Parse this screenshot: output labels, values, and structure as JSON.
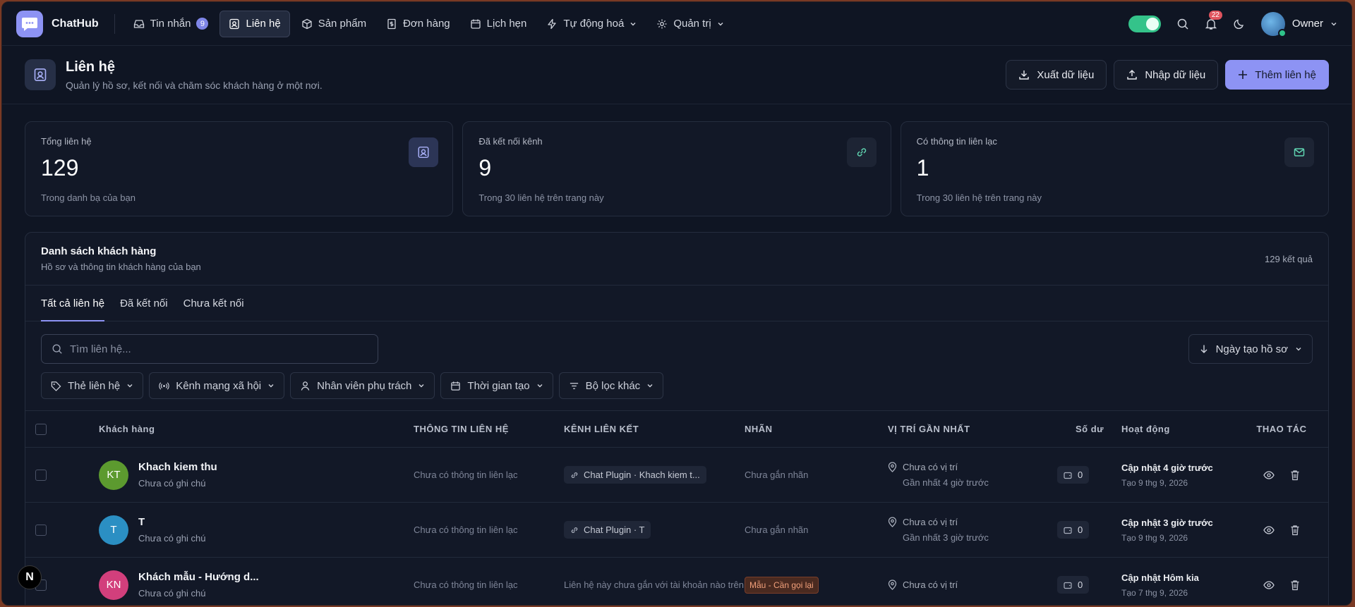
{
  "app": {
    "brand": "ChatHub",
    "nav": [
      {
        "label": "Tin nhắn",
        "badge": "9",
        "icon": "inbox-icon"
      },
      {
        "label": "Liên hệ",
        "icon": "contact-icon",
        "active": true
      },
      {
        "label": "Sản phẩm",
        "icon": "box-icon"
      },
      {
        "label": "Đơn hàng",
        "icon": "receipt-icon"
      },
      {
        "label": "Lịch hẹn",
        "icon": "calendar-icon"
      },
      {
        "label": "Tự động hoá",
        "icon": "bolt-icon",
        "dropdown": true
      },
      {
        "label": "Quản trị",
        "icon": "gear-icon",
        "dropdown": true
      }
    ],
    "notification_count": "22",
    "user_name": "Owner"
  },
  "page": {
    "title": "Liên hệ",
    "subtitle": "Quản lý hồ sơ, kết nối và chăm sóc khách hàng ở một nơi.",
    "export_label": "Xuất dữ liệu",
    "import_label": "Nhập dữ liệu",
    "add_label": "Thêm liên hệ"
  },
  "stats": [
    {
      "label": "Tổng liên hệ",
      "value": "129",
      "note": "Trong danh bạ của bạn",
      "icon": "contact-icon"
    },
    {
      "label": "Đã kết nối kênh",
      "value": "9",
      "note": "Trong 30 liên hệ trên trang này",
      "icon": "link-icon"
    },
    {
      "label": "Có thông tin liên lạc",
      "value": "1",
      "note": "Trong 30 liên hệ trên trang này",
      "icon": "mail-icon"
    }
  ],
  "list": {
    "title": "Danh sách khách hàng",
    "subtitle": "Hồ sơ và thông tin khách hàng của bạn",
    "result_count": "129 kết quả",
    "tabs": [
      "Tất cả liên hệ",
      "Đã kết nối",
      "Chưa kết nối"
    ],
    "search_placeholder": "Tìm liên hệ...",
    "sort_label": "Ngày tạo hồ sơ",
    "filters": [
      "Thẻ liên hệ",
      "Kênh mạng xã hội",
      "Nhân viên phụ trách",
      "Thời gian tạo",
      "Bộ lọc khác"
    ],
    "columns": {
      "customer": "Khách hàng",
      "contact": "THÔNG TIN LIÊN HỆ",
      "channel": "KÊNH LIÊN KẾT",
      "tag": "NHÃN",
      "location": "VỊ TRÍ GẦN NHẤT",
      "balance": "Số dư",
      "activity": "Hoạt động",
      "actions": "THAO TÁC"
    },
    "rows": [
      {
        "initials": "KT",
        "avatar_color": "#5c9a2f",
        "name": "Khach kiem thu",
        "note": "Chưa có ghi chú",
        "contact": "Chưa có thông tin liên lạc",
        "channel": "Chat Plugin · Khach kiem t...",
        "tag": "Chưa gắn nhãn",
        "location": "Chưa có vị trí",
        "location_sub": "Gần nhất 4 giờ trước",
        "balance": "0",
        "activity": "Cập nhật 4 giờ trước",
        "created": "Tạo 9 thg 9, 2026"
      },
      {
        "initials": "T",
        "avatar_color": "#2b8fc3",
        "name": "T",
        "note": "Chưa có ghi chú",
        "contact": "Chưa có thông tin liên lạc",
        "channel": "Chat Plugin · T",
        "tag": "Chưa gắn nhãn",
        "location": "Chưa có vị trí",
        "location_sub": "Gần nhất 3 giờ trước",
        "balance": "0",
        "activity": "Cập nhật 3 giờ trước",
        "created": "Tạo 9 thg 9, 2026"
      },
      {
        "initials": "KN",
        "avatar_color": "#d23f7c",
        "name": "Khách mẫu - Hướng d...",
        "note": "Chưa có ghi chú",
        "contact": "Chưa có thông tin liên lạc",
        "channel_unlinked": "Liên hệ này chưa gắn với tài khoản nào trên",
        "tag_label": "Mẫu - Cần gọi lại",
        "location": "Chưa có vị trí",
        "balance": "0",
        "activity": "Cập nhật Hôm kia",
        "created": "Tạo 7 thg 9, 2026"
      }
    ]
  },
  "colors": {
    "accent": "#8d93f4",
    "success": "#34c38a",
    "danger": "#e0545e",
    "background": "#0f1523"
  }
}
